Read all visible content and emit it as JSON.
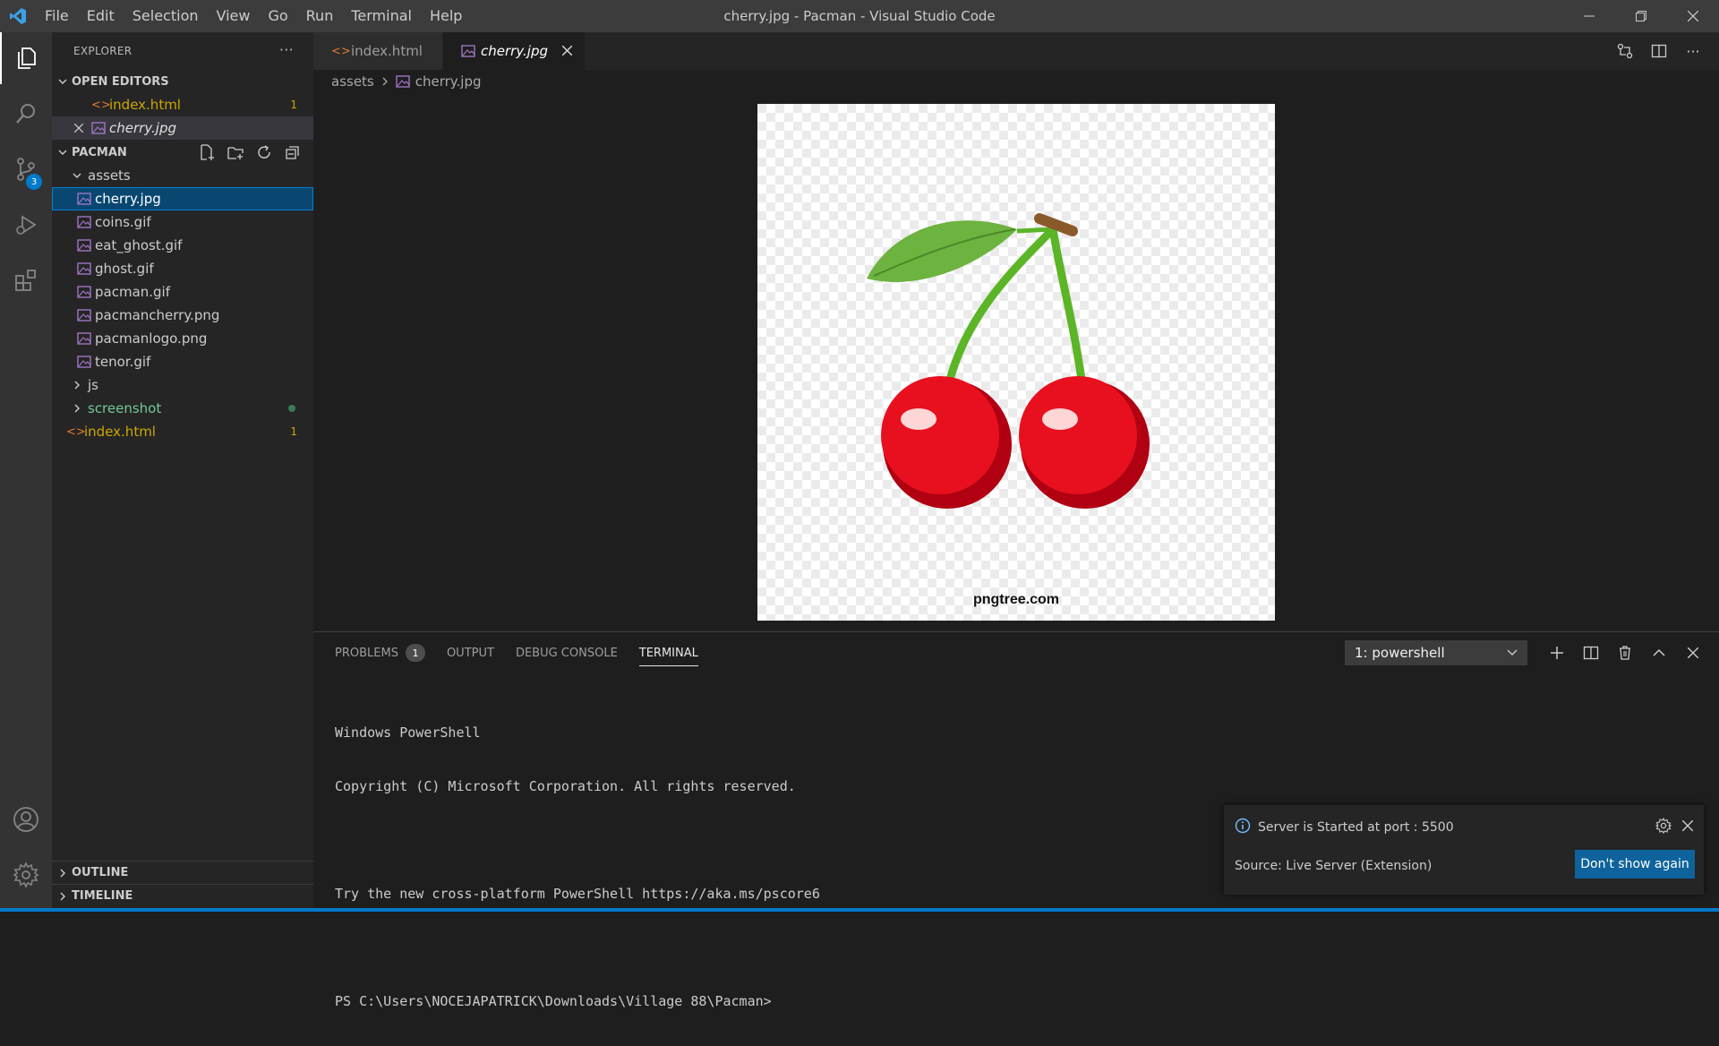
{
  "titlebar": {
    "menu": [
      "File",
      "Edit",
      "Selection",
      "View",
      "Go",
      "Run",
      "Terminal",
      "Help"
    ],
    "title": "cherry.jpg - Pacman - Visual Studio Code"
  },
  "activity": {
    "scm_badge": "3"
  },
  "sidebar": {
    "title": "EXPLORER",
    "open_editors": {
      "heading": "OPEN EDITORS",
      "items": [
        {
          "label": "index.html",
          "count": "1"
        },
        {
          "label": "cherry.jpg"
        }
      ]
    },
    "project": {
      "heading": "PACMAN",
      "folder_assets": "assets",
      "assets": [
        "cherry.jpg",
        "coins.gif",
        "eat_ghost.gif",
        "ghost.gif",
        "pacman.gif",
        "pacmancherry.png",
        "pacmanlogo.png",
        "tenor.gif"
      ],
      "folder_js": "js",
      "folder_screenshot": "screenshot",
      "index": {
        "label": "index.html",
        "count": "1"
      }
    },
    "outline": "OUTLINE",
    "timeline": "TIMELINE"
  },
  "editor": {
    "tabs": [
      {
        "label": "index.html"
      },
      {
        "label": "cherry.jpg"
      }
    ],
    "breadcrumb": {
      "folder": "assets",
      "file": "cherry.jpg"
    },
    "image_watermark": "pngtree.com"
  },
  "panel": {
    "tabs": {
      "problems": "PROBLEMS",
      "problems_count": "1",
      "output": "OUTPUT",
      "debug": "DEBUG CONSOLE",
      "terminal": "TERMINAL"
    },
    "terminal_select": "1: powershell",
    "terminal_lines": [
      "Windows PowerShell",
      "Copyright (C) Microsoft Corporation. All rights reserved.",
      "",
      "Try the new cross-platform PowerShell https://aka.ms/pscore6",
      "",
      "PS C:\\Users\\NOCEJAPATRICK\\Downloads\\Village 88\\Pacman>"
    ]
  },
  "notification": {
    "message": "Server is Started at port : 5500",
    "source": "Source: Live Server (Extension)",
    "button": "Don't show again"
  },
  "colors": {
    "accent": "#007acc",
    "modified": "#cca700",
    "html_icon": "#e37933",
    "image_icon": "#a074c4"
  }
}
